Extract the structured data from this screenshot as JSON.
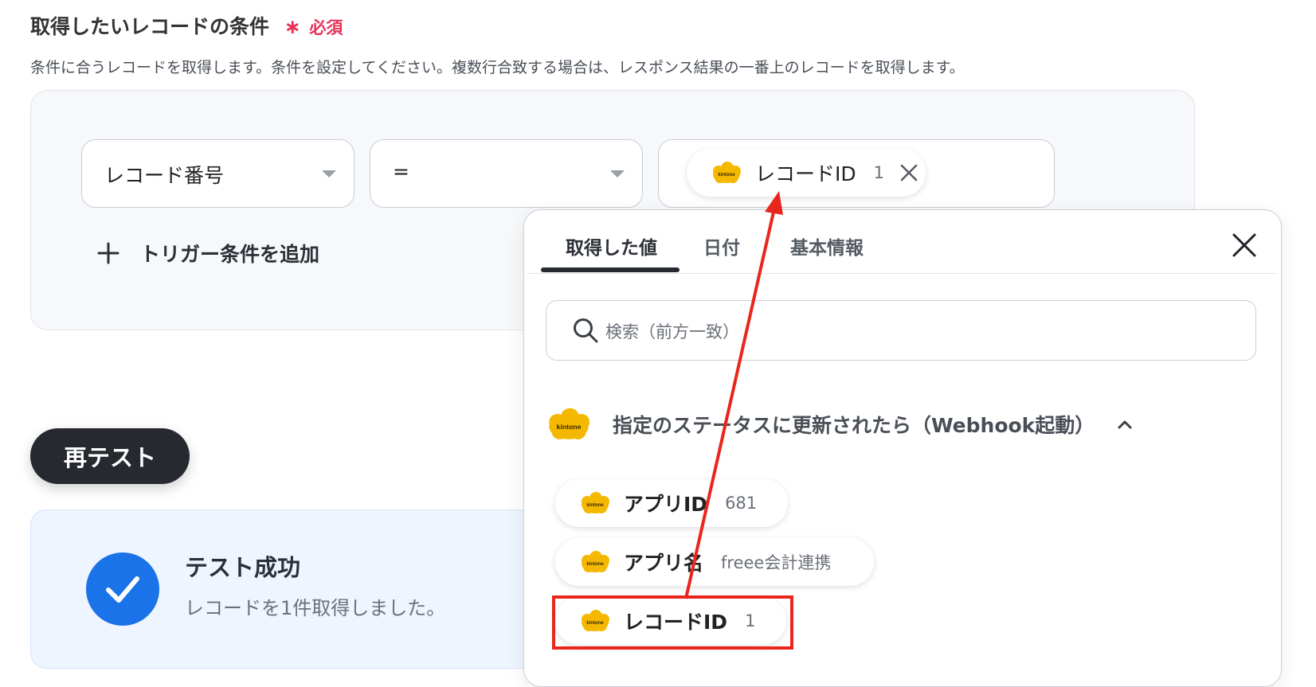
{
  "form": {
    "title": "取得したいレコードの条件",
    "required_mark": "∗",
    "required_label": "必須",
    "description": "条件に合うレコードを取得します。条件を設定してください。複数行合致する場合は、レスポンス結果の一番上のレコードを取得します。"
  },
  "condition": {
    "field_select": "レコード番号",
    "operator_select": "=",
    "value_chip": {
      "label": "レコードID",
      "value": "1",
      "icon": "kintone-logo-icon"
    },
    "add_button": "トリガー条件を追加"
  },
  "retest_button": "再テスト",
  "result": {
    "title": "テスト成功",
    "message": "レコードを1件取得しました。"
  },
  "popup": {
    "tabs": [
      "取得した値",
      "日付",
      "基本情報"
    ],
    "active_tab": 0,
    "search_placeholder": "検索（前方一致）",
    "group_title": "指定のステータスに更新されたら（Webhook起動）",
    "items": [
      {
        "label": "アプリID",
        "value": "681"
      },
      {
        "label": "アプリ名",
        "value": "freee会計連携"
      },
      {
        "label": "レコードID",
        "value": "1"
      }
    ],
    "highlighted_item": 2
  },
  "colors": {
    "required": "#e8325a",
    "highlight": "#e8261e",
    "success": "#1a73e8",
    "kintone": "#f5b800",
    "dark_button": "#262a30"
  }
}
